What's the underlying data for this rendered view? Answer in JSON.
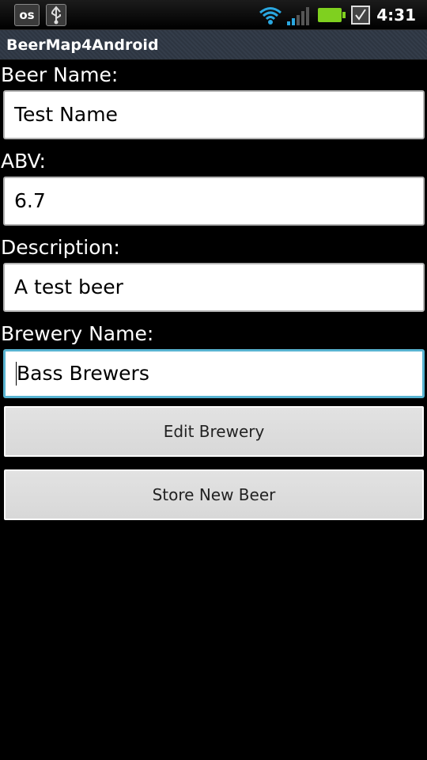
{
  "status_bar": {
    "left_icons": [
      {
        "icon": "lastfm-icon",
        "text": "os"
      },
      {
        "icon": "usb-icon"
      }
    ],
    "right_icons": [
      "wifi-icon",
      "signal-icon",
      "battery-icon",
      "checkbox-icon"
    ],
    "battery_color": "#7fd01f",
    "clock": "4:31"
  },
  "app": {
    "title": "BeerMap4Android"
  },
  "form": {
    "beer_name": {
      "label": "Beer Name:",
      "value": "Test Name"
    },
    "abv": {
      "label": "ABV:",
      "value": "6.7"
    },
    "description": {
      "label": "Description:",
      "value": "A test beer"
    },
    "brewery_name": {
      "label": "Brewery Name:",
      "value": "Bass Brewers"
    },
    "edit_brewery_label": "Edit Brewery",
    "store_label": "Store New Beer"
  },
  "colors": {
    "focus": "#58b3d1",
    "background": "#000000"
  }
}
